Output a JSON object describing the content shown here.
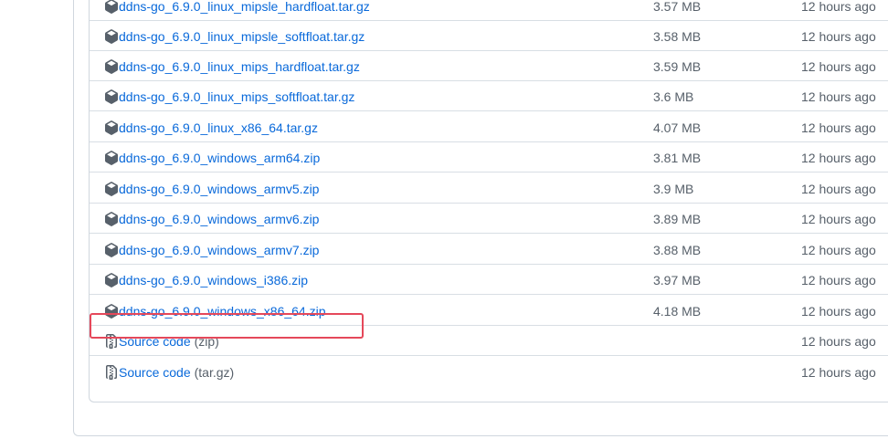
{
  "assets": [
    {
      "name": "ddns-go_6.9.0_linux_mipsle_hardfloat.tar.gz",
      "size": "3.57 MB",
      "time": "12 hours ago",
      "icon": "package-icon"
    },
    {
      "name": "ddns-go_6.9.0_linux_mipsle_softfloat.tar.gz",
      "size": "3.58 MB",
      "time": "12 hours ago",
      "icon": "package-icon"
    },
    {
      "name": "ddns-go_6.9.0_linux_mips_hardfloat.tar.gz",
      "size": "3.59 MB",
      "time": "12 hours ago",
      "icon": "package-icon"
    },
    {
      "name": "ddns-go_6.9.0_linux_mips_softfloat.tar.gz",
      "size": "3.6 MB",
      "time": "12 hours ago",
      "icon": "package-icon"
    },
    {
      "name": "ddns-go_6.9.0_linux_x86_64.tar.gz",
      "size": "4.07 MB",
      "time": "12 hours ago",
      "icon": "package-icon"
    },
    {
      "name": "ddns-go_6.9.0_windows_arm64.zip",
      "size": "3.81 MB",
      "time": "12 hours ago",
      "icon": "package-icon"
    },
    {
      "name": "ddns-go_6.9.0_windows_armv5.zip",
      "size": "3.9 MB",
      "time": "12 hours ago",
      "icon": "package-icon"
    },
    {
      "name": "ddns-go_6.9.0_windows_armv6.zip",
      "size": "3.89 MB",
      "time": "12 hours ago",
      "icon": "package-icon"
    },
    {
      "name": "ddns-go_6.9.0_windows_armv7.zip",
      "size": "3.88 MB",
      "time": "12 hours ago",
      "icon": "package-icon"
    },
    {
      "name": "ddns-go_6.9.0_windows_i386.zip",
      "size": "3.97 MB",
      "time": "12 hours ago",
      "icon": "package-icon"
    },
    {
      "name": "ddns-go_6.9.0_windows_x86_64.zip",
      "size": "4.18 MB",
      "time": "12 hours ago",
      "icon": "package-icon"
    }
  ],
  "source_code": [
    {
      "label": "Source code",
      "suffix": "(zip)",
      "time": "12 hours ago",
      "icon": "file-zip-icon"
    },
    {
      "label": "Source code",
      "suffix": "(tar.gz)",
      "time": "12 hours ago",
      "icon": "file-zip-icon"
    }
  ],
  "highlight_color": "#e5485a",
  "link_color": "#0969da"
}
